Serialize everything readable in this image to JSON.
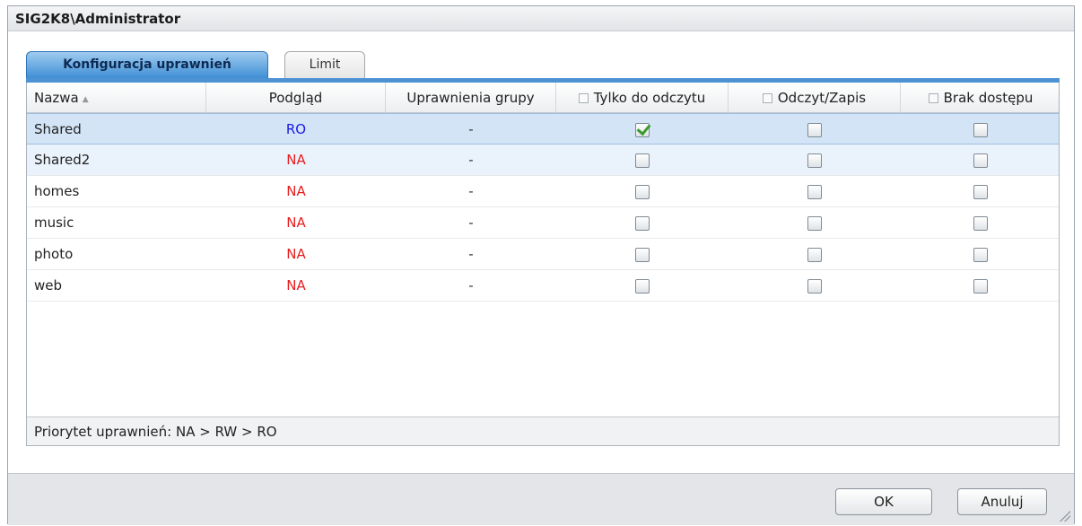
{
  "window": {
    "title": "SIG2K8\\Administrator"
  },
  "tabs": [
    {
      "label": "Konfiguracja uprawnień",
      "active": true
    },
    {
      "label": "Limit",
      "active": false
    }
  ],
  "grid": {
    "columns": {
      "name": "Nazwa",
      "preview": "Podgląd",
      "group": "Uprawnienia grupy",
      "readonly": "Tylko do odczytu",
      "readwrite": "Odczyt/Zapis",
      "noaccess": "Brak dostępu"
    },
    "rows": [
      {
        "name": "Shared",
        "preview": "RO",
        "group": "-",
        "readonly": true,
        "readwrite": false,
        "noaccess": false
      },
      {
        "name": "Shared2",
        "preview": "NA",
        "group": "-",
        "readonly": false,
        "readwrite": false,
        "noaccess": false
      },
      {
        "name": "homes",
        "preview": "NA",
        "group": "-",
        "readonly": false,
        "readwrite": false,
        "noaccess": false
      },
      {
        "name": "music",
        "preview": "NA",
        "group": "-",
        "readonly": false,
        "readwrite": false,
        "noaccess": false
      },
      {
        "name": "photo",
        "preview": "NA",
        "group": "-",
        "readonly": false,
        "readwrite": false,
        "noaccess": false
      },
      {
        "name": "web",
        "preview": "NA",
        "group": "-",
        "readonly": false,
        "readwrite": false,
        "noaccess": false
      }
    ],
    "status": "Priorytet uprawnień: NA > RW > RO"
  },
  "buttons": {
    "ok": "OK",
    "cancel": "Anuluj"
  },
  "colors": {
    "ro": "#1a1ae6",
    "na": "#e61e1e",
    "accent": "#3f8fd6"
  }
}
